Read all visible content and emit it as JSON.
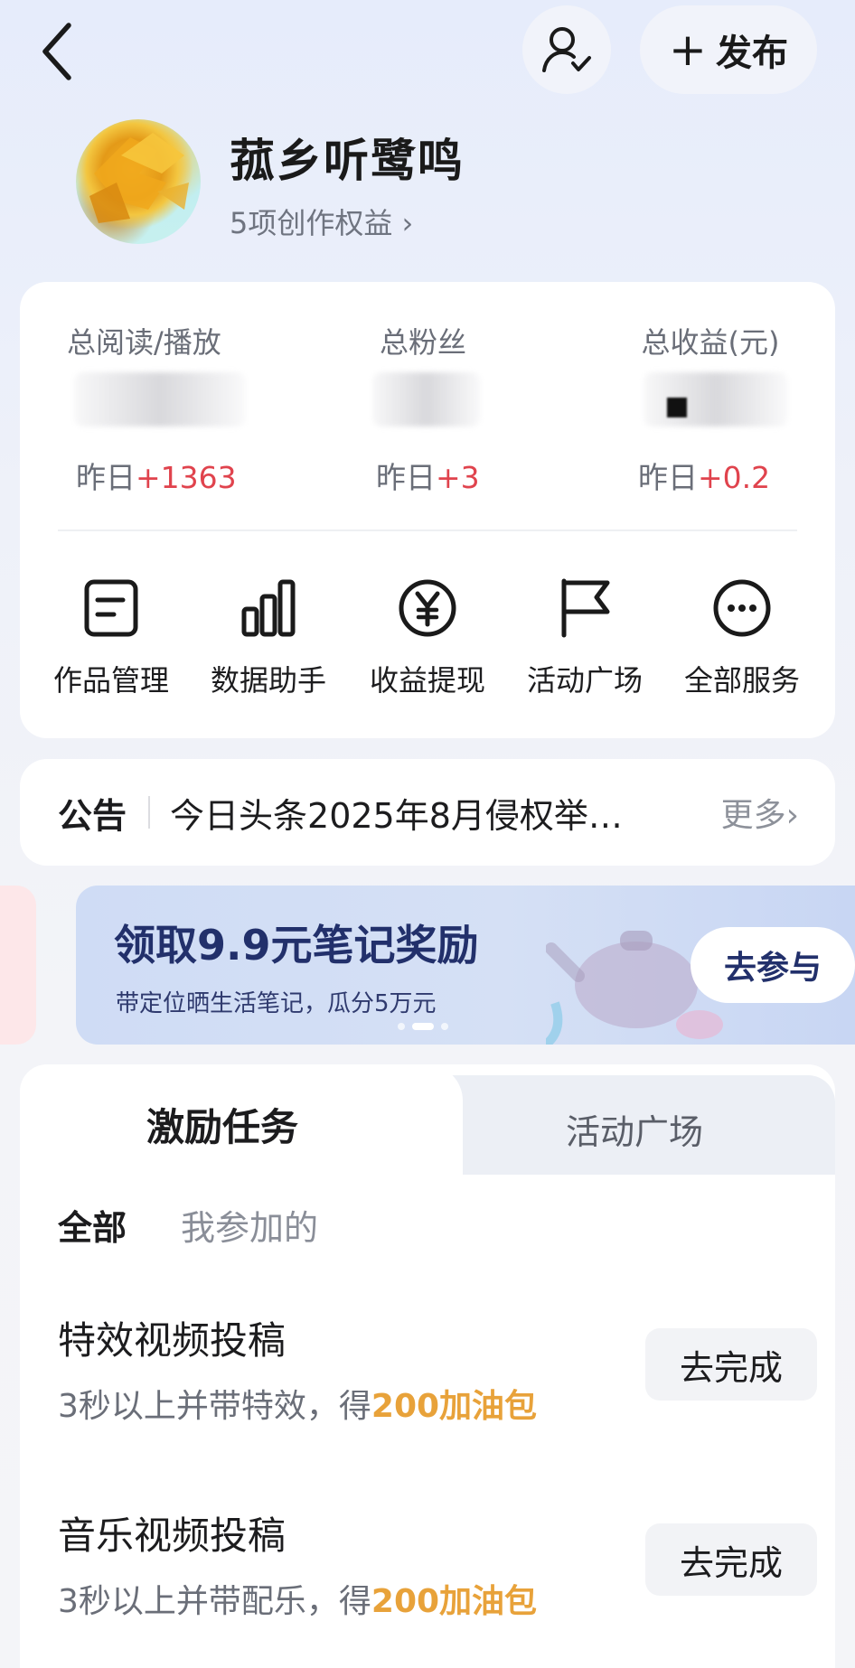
{
  "header": {
    "back_icon": "chevron-left-icon",
    "user_icon": "user-check-icon",
    "publish_label": "发布"
  },
  "profile": {
    "name": "菰乡听鹭鸣",
    "benefits": "5项创作权益 ›"
  },
  "stats": [
    {
      "label": "总阅读/播放",
      "yesterday_prefix": "昨日",
      "yesterday_delta": "+1363"
    },
    {
      "label": "总粉丝",
      "yesterday_prefix": "昨日",
      "yesterday_delta": "+3"
    },
    {
      "label": "总收益(元)",
      "yesterday_prefix": "昨日",
      "yesterday_delta": "+0.2"
    }
  ],
  "services": [
    {
      "label": "作品管理",
      "icon": "document-icon"
    },
    {
      "label": "数据助手",
      "icon": "bar-chart-icon"
    },
    {
      "label": "收益提现",
      "icon": "yen-circle-icon"
    },
    {
      "label": "活动广场",
      "icon": "flag-icon"
    },
    {
      "label": "全部服务",
      "icon": "more-circle-icon"
    }
  ],
  "notice": {
    "tag": "公告",
    "text": "今日头条2025年8月侵权举…",
    "more": "更多›"
  },
  "banner": {
    "title": "领取9.9元笔记奖励",
    "subtitle": "带定位晒生活笔记，瓜分5万元",
    "cta": "去参与"
  },
  "tasks": {
    "tab_active": "激励任务",
    "tab_inactive": "活动广场",
    "filter_all": "全部",
    "filter_joined": "我参加的",
    "items": [
      {
        "title": "特效视频投稿",
        "desc_prefix": "3秒以上并带特效，得",
        "reward": "200加油包",
        "button": "去完成"
      },
      {
        "title": "音乐视频投稿",
        "desc_prefix": "3秒以上并带配乐，得",
        "reward": "200加油包",
        "button": "去完成"
      }
    ]
  },
  "colors": {
    "accent_red": "#e0434d",
    "reward_orange": "#e8a23a",
    "banner_navy": "#22306b"
  }
}
